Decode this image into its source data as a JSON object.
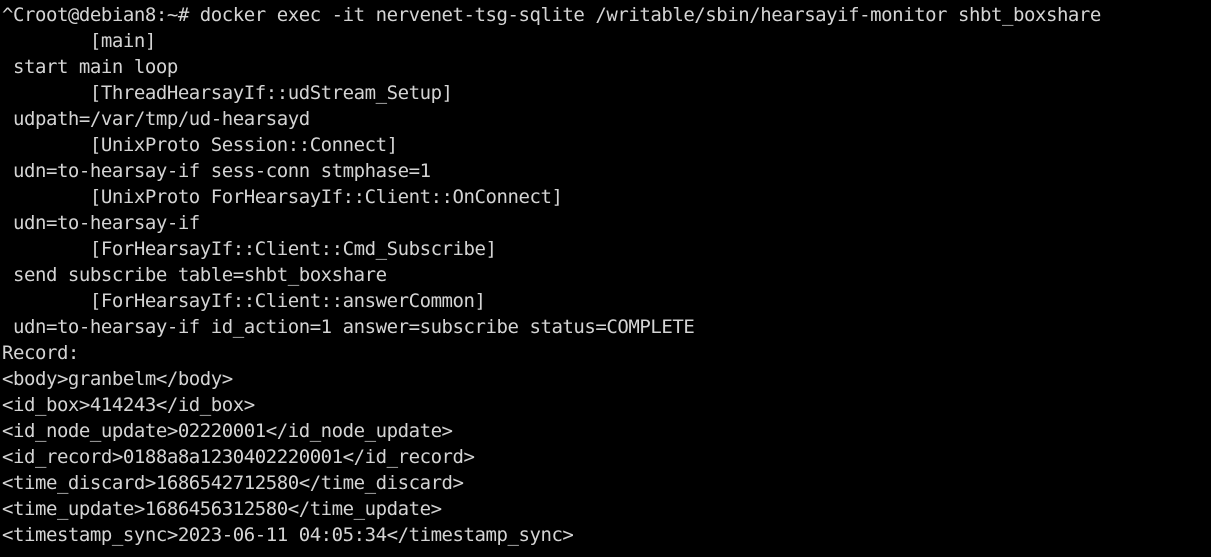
{
  "terminal": {
    "colors": {
      "background": "#000000",
      "foreground": "#d4d4d4"
    },
    "lines": [
      "^Croot@debian8:~# docker exec -it nervenet-tsg-sqlite /writable/sbin/hearsayif-monitor shbt_boxshare",
      "        [main]",
      " start main loop",
      "        [ThreadHearsayIf::udStream_Setup]",
      " udpath=/var/tmp/ud-hearsayd",
      "        [UnixProto Session::Connect]",
      " udn=to-hearsay-if sess-conn stmphase=1",
      "        [UnixProto ForHearsayIf::Client::OnConnect]",
      " udn=to-hearsay-if",
      "        [ForHearsayIf::Client::Cmd_Subscribe]",
      " send subscribe table=shbt_boxshare",
      "        [ForHearsayIf::Client::answerCommon]",
      " udn=to-hearsay-if id_action=1 answer=subscribe status=COMPLETE",
      "Record:",
      "<body>granbelm</body>",
      "<id_box>414243</id_box>",
      "<id_node_update>02220001</id_node_update>",
      "<id_record>0188a8a1230402220001</id_record>",
      "<time_discard>1686542712580</time_discard>",
      "<time_update>1686456312580</time_update>",
      "<timestamp_sync>2023-06-11 04:05:34</timestamp_sync>"
    ]
  }
}
